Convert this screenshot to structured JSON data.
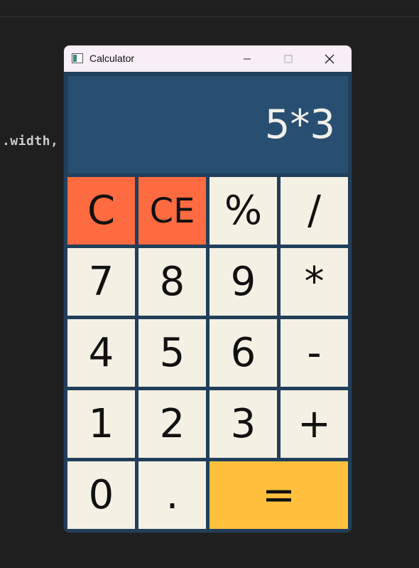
{
  "background": {
    "code_fragment": ".width,"
  },
  "window": {
    "title": "Calculator",
    "controls": {
      "minimize": "—",
      "maximize": "☐",
      "close": "✕"
    }
  },
  "display": {
    "value": "5*3"
  },
  "colors": {
    "display_bg": "#284f72",
    "frame": "#213f5b",
    "key_default": "#f5f0e4",
    "key_clear": "#ff6b40",
    "key_equals": "#ffc13d"
  },
  "keys": {
    "c": "C",
    "ce": "CE",
    "percent": "%",
    "divide": "/",
    "seven": "7",
    "eight": "8",
    "nine": "9",
    "multiply": "*",
    "four": "4",
    "five": "5",
    "six": "6",
    "subtract": "-",
    "one": "1",
    "two": "2",
    "three": "3",
    "add": "+",
    "zero": "0",
    "decimal": ".",
    "equals": "="
  }
}
